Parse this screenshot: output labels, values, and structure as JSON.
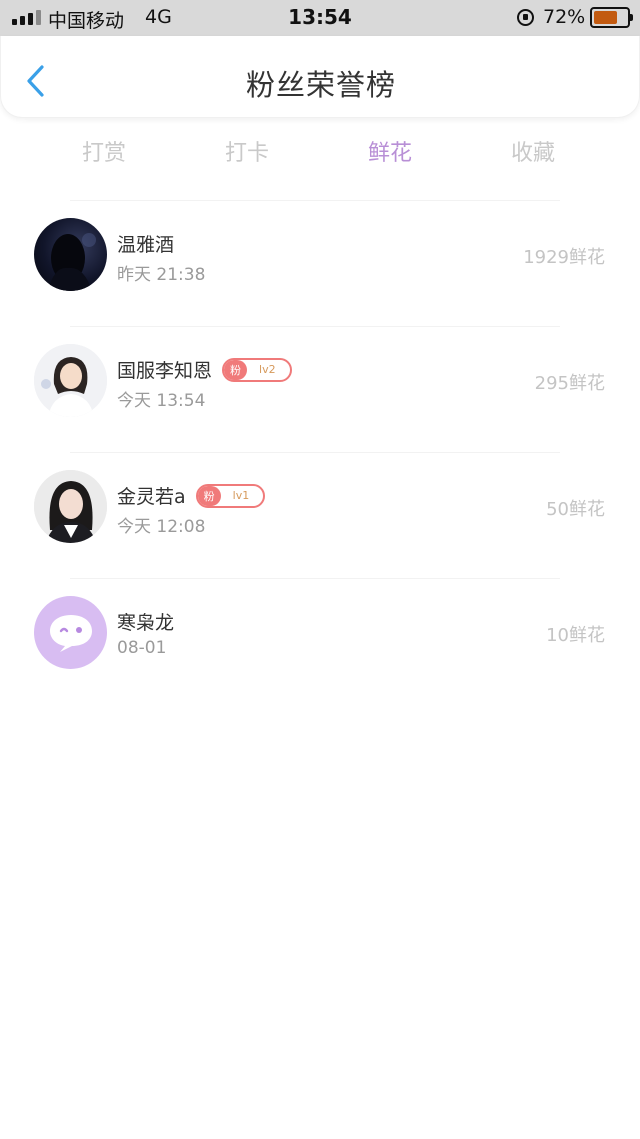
{
  "status_bar": {
    "carrier": "中国移动",
    "network": "4G",
    "time": "13:54",
    "battery_percent": "72%",
    "battery_level": 0.72
  },
  "header": {
    "title": "粉丝荣誉榜",
    "back_icon": "chevron-left-icon"
  },
  "tabs": [
    {
      "label": "打赏",
      "active": false
    },
    {
      "label": "打卡",
      "active": false
    },
    {
      "label": "鲜花",
      "active": true
    },
    {
      "label": "收藏",
      "active": false
    }
  ],
  "colors": {
    "accent": "#b88fd6",
    "back_icon": "#3aa0e8",
    "badge": "#f07a7a",
    "muted_text": "#c4c4c4"
  },
  "fans": [
    {
      "name": "温雅酒",
      "time": "昨天 21:38",
      "value": "1929鲜花",
      "badge": null
    },
    {
      "name": "国服李知恩",
      "time": "今天 13:54",
      "value": "295鲜花",
      "badge": {
        "tag": "粉",
        "level": "lv2"
      }
    },
    {
      "name": "金灵若a",
      "time": "今天 12:08",
      "value": "50鲜花",
      "badge": {
        "tag": "粉",
        "level": "lv1"
      }
    },
    {
      "name": "寒枭龙",
      "time": "08-01",
      "value": "10鲜花",
      "badge": null
    }
  ]
}
